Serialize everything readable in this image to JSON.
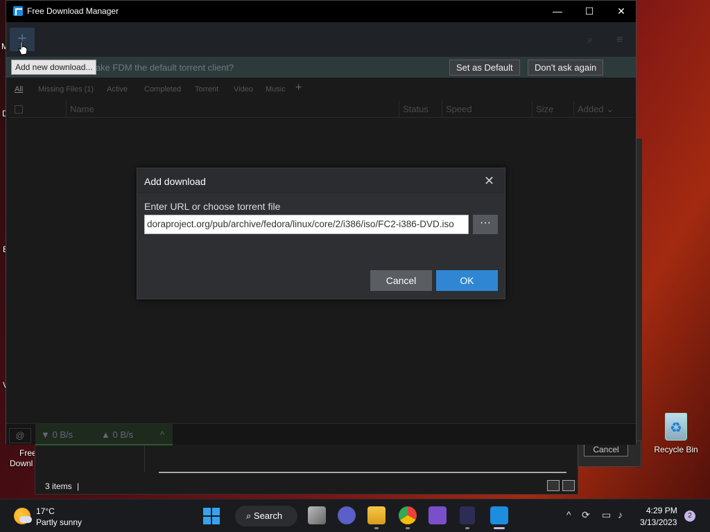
{
  "window": {
    "title": "Free Download Manager",
    "minimize": "—",
    "maximize": "☐",
    "close": "✕"
  },
  "toolbar": {
    "add_tooltip": "Add new download..."
  },
  "notice": {
    "text": "make FDM the default torrent client?",
    "set_default": "Set as Default",
    "dont_ask": "Don't ask again"
  },
  "filters": [
    "All",
    "Missing Files (1)",
    "Active",
    "Completed",
    "Torrent",
    "Video",
    "Music"
  ],
  "columns": {
    "name": "Name",
    "status": "Status",
    "speed": "Speed",
    "size": "Size",
    "added": "Added ⌄"
  },
  "statusbar": {
    "down_speed": "▼ 0 B/s",
    "up_speed": "▲ 0 B/s"
  },
  "dialog": {
    "title": "Add download",
    "label": "Enter URL or choose torrent file",
    "url_value": "doraproject.org/pub/archive/fedora/linux/core/2/i386/iso/FC2-i386-DVD.iso",
    "browse": "···",
    "cancel": "Cancel",
    "ok": "OK"
  },
  "background_window": {
    "items": "3 items",
    "cancel": "Cancel"
  },
  "desktop": {
    "left_partial": [
      "M",
      "D",
      "E",
      "V"
    ],
    "free_label_1": "Free",
    "free_label_2": "Downl",
    "recycle_bin": "Recycle Bin"
  },
  "taskbar": {
    "temp": "17°C",
    "weather": "Partly sunny",
    "search": "Search",
    "time": "4:29 PM",
    "date": "3/13/2023",
    "notifications": "2"
  },
  "colors": {
    "accent": "#2f87d3",
    "dialog_bg": "#2d2f32"
  }
}
